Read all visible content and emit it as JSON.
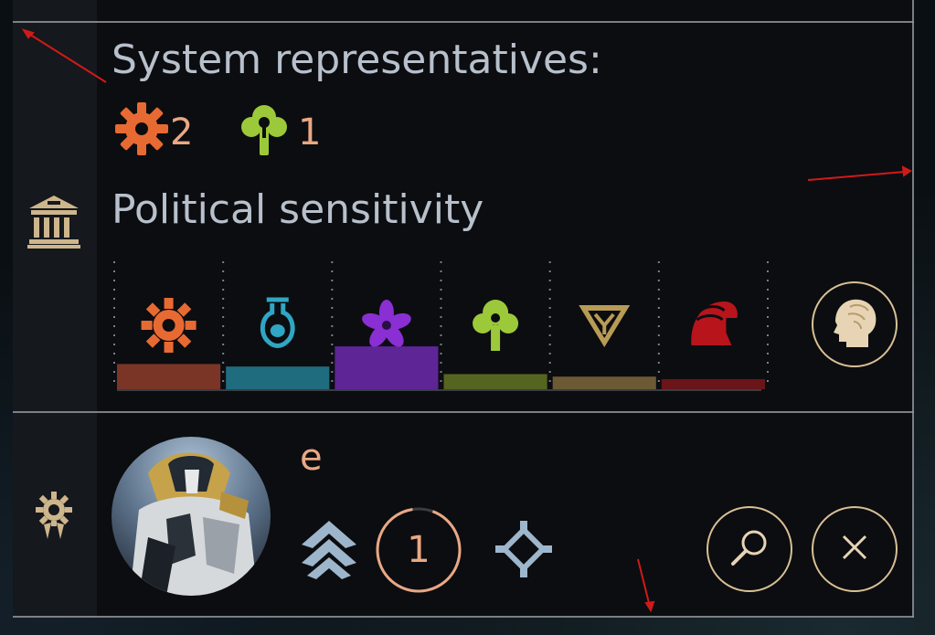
{
  "colors": {
    "industry": "#e86a33",
    "science": "#2fa6c4",
    "influence": "#8a2fd3",
    "food": "#9cc93a",
    "dust": "#b89b55",
    "military": "#b8141c",
    "gold": "#d9c095",
    "peach": "#e9a884",
    "text": "#b7c0cb"
  },
  "system": {
    "representatives_title": "System representatives:",
    "representatives": [
      {
        "icon": "gear-icon",
        "value": "2"
      },
      {
        "icon": "tree-icon",
        "value": "1"
      }
    ]
  },
  "political": {
    "title": "Political sensitivity",
    "section_icon": "senate-building-icon",
    "side_button_icon": "head-profile-icon"
  },
  "chart_data": {
    "type": "bar",
    "categories": [
      "industry",
      "science",
      "influence",
      "food",
      "dust",
      "military"
    ],
    "values": [
      2,
      1.8,
      3.4,
      1.2,
      1,
      0.8
    ],
    "ylim": [
      0,
      10
    ],
    "colors": [
      "#7a3527",
      "#1f6c7e",
      "#5d2595",
      "#55651f",
      "#6b5a33",
      "#6a1519"
    ],
    "icon_colors": [
      "#e86a33",
      "#2fa6c4",
      "#8a2fd3",
      "#9cc93a",
      "#b89b55",
      "#b8141c"
    ],
    "icons": [
      "gear-icon",
      "flask-icon",
      "flower-icon",
      "tree-icon",
      "triangle-icon",
      "helmet-icon"
    ],
    "grid": true
  },
  "hero": {
    "name": "e",
    "level": "1",
    "section_icon": "gear-medal-icon",
    "rank_icon": "chevron-rank-icon",
    "class_icon": "diamond-reticle-icon",
    "inspect_icon": "magnifier-icon",
    "dismiss_icon": "close-icon"
  }
}
